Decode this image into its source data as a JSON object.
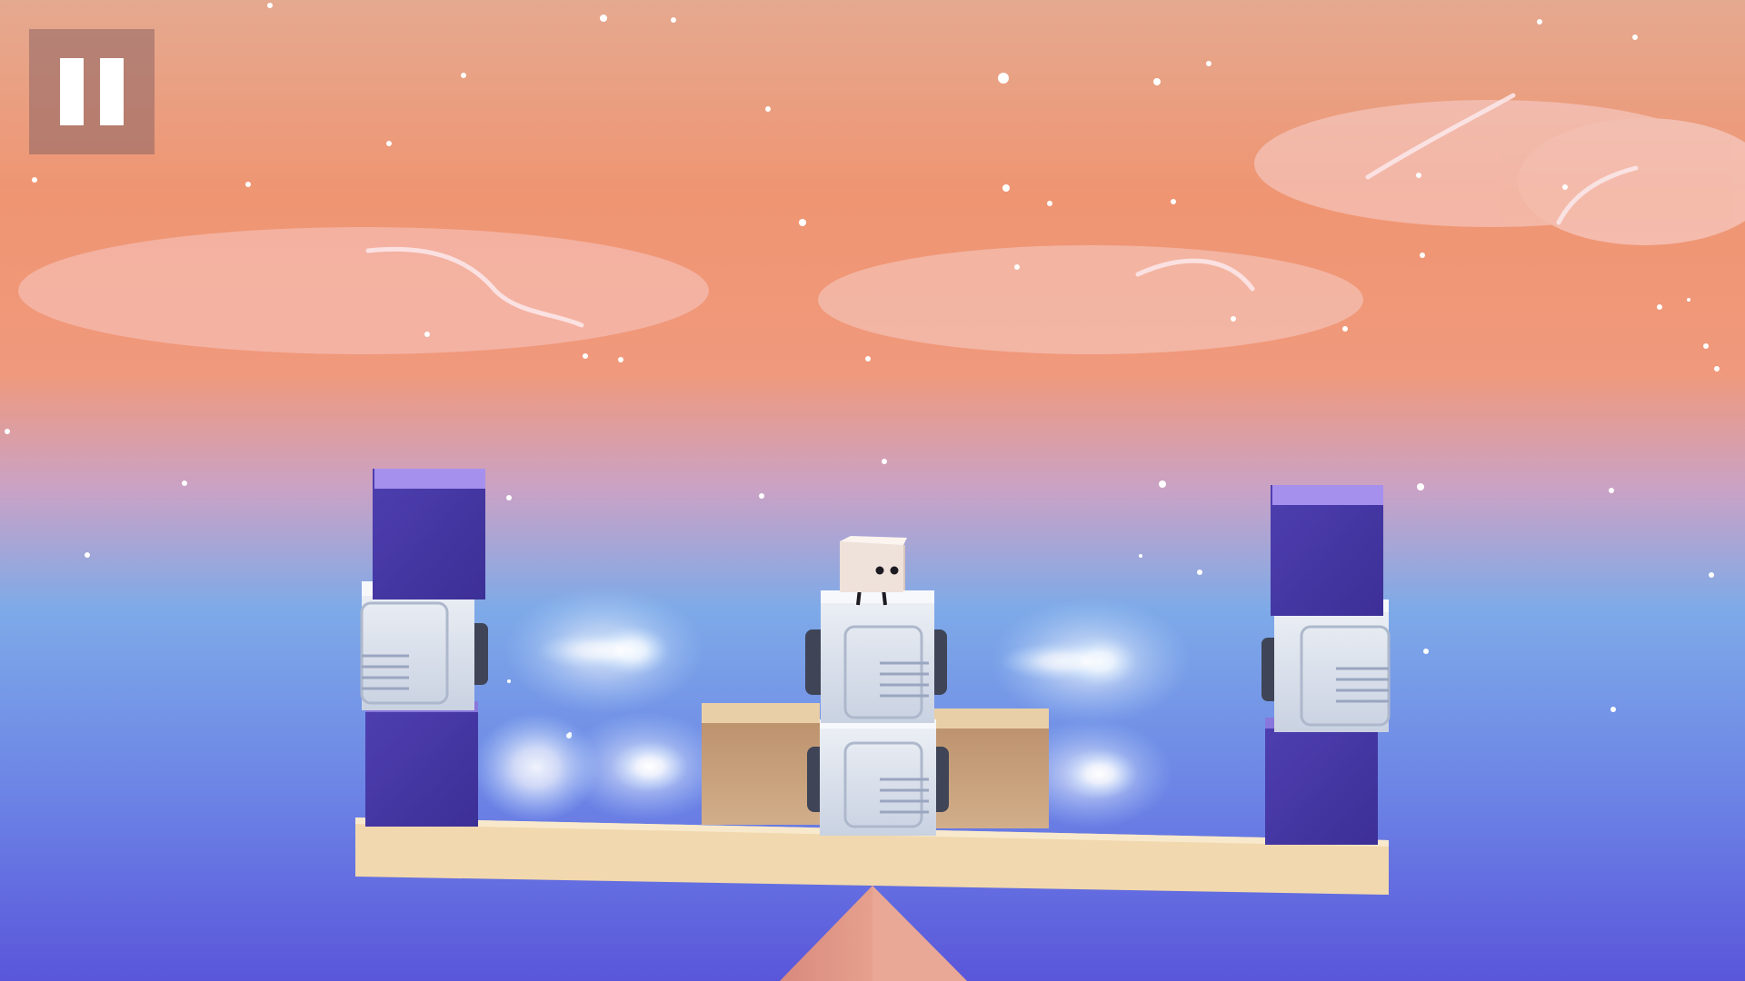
{
  "game": {
    "scene": "balance-seesaw-puzzle",
    "pause_button": {
      "icon": "pause-icon"
    }
  },
  "colors": {
    "sky_top": "#e8a78c",
    "sky_orange": "#ef8e6e",
    "sky_blue": "#6aa6ea",
    "sky_bottom": "#5a57d8",
    "plank": "#f4dcb2",
    "purple_block": "#4a3aa6",
    "purple_block_top": "#a48ef0",
    "metal_block": "#dde3ec",
    "wood_crate": "#c79c74",
    "fulcrum": "#d88a7e"
  }
}
